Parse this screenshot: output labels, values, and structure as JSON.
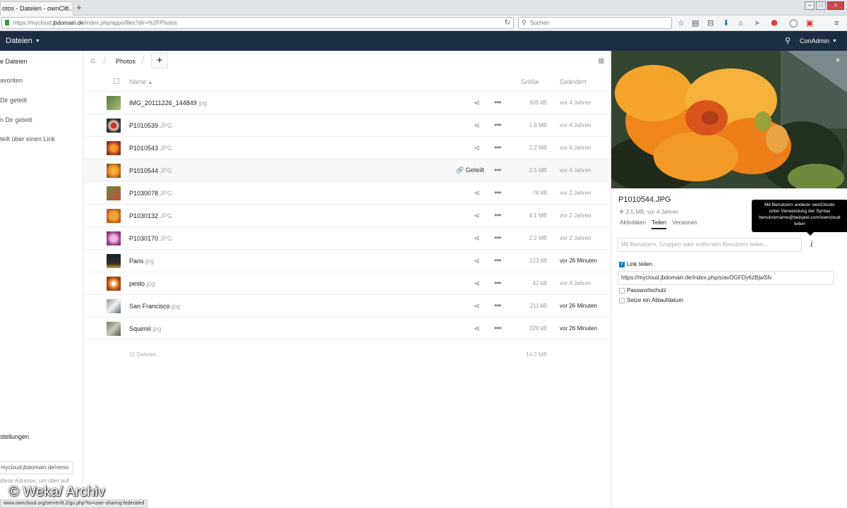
{
  "browser": {
    "tab_title": "otos - Dateien - ownClo...",
    "tab_close": "×",
    "new_tab": "+",
    "url_prefix": "https://mycloud.",
    "url_domain": "jbdomain.de",
    "url_path": "/index.php/apps/files?dir=%2FPhotos",
    "search_placeholder": "Suchen",
    "status_url": "www.owncloud.org/server/8.2/go.php?to=user-sharing-federated"
  },
  "header": {
    "app_name": "Dateien",
    "user_name": "ConAdmin"
  },
  "nav": {
    "items": [
      {
        "label": "e Dateien"
      },
      {
        "label": "avoriten"
      },
      {
        "label": "Dir geteilt"
      },
      {
        "label": "n Dir geteilt"
      },
      {
        "label": "teilt über einen Link"
      }
    ],
    "settings_label": "stellungen",
    "webdav_value": "mycloud.jbdomain.de/remo",
    "webdav_hint": "diese Adresse, um über auf"
  },
  "breadcrumb": {
    "folder": "Photos",
    "new_label": "+"
  },
  "columns": {
    "name": "Name",
    "size": "Größe",
    "modified": "Geändert"
  },
  "files": [
    {
      "name": "IMG_20111226_144849",
      "ext": ".jpg",
      "size": "605 kB",
      "modified": "vor 4 Jahren",
      "recent": false,
      "shared": false
    },
    {
      "name": "P1010539",
      "ext": ".JPG",
      "size": "1.9 MB",
      "modified": "vor 4 Jahren",
      "recent": false,
      "shared": false
    },
    {
      "name": "P1010543",
      "ext": ".JPG",
      "size": "2.2 MB",
      "modified": "vor 4 Jahren",
      "recent": false,
      "shared": false
    },
    {
      "name": "P1010544",
      "ext": ".JPG",
      "size": "2.5 MB",
      "modified": "vor 4 Jahren",
      "recent": false,
      "shared": true
    },
    {
      "name": "P1030078",
      "ext": ".JPG",
      "size": "76 kB",
      "modified": "vor 2 Jahren",
      "recent": false,
      "shared": false
    },
    {
      "name": "P1030132",
      "ext": ".JPG",
      "size": "4.1 MB",
      "modified": "vor 2 Jahren",
      "recent": false,
      "shared": false
    },
    {
      "name": "P1030170",
      "ext": ".JPG",
      "size": "2.2 MB",
      "modified": "vor 2 Jahren",
      "recent": false,
      "shared": false
    },
    {
      "name": "Paris",
      "ext": ".jpg",
      "size": "223 kB",
      "modified": "vor 26 Minuten",
      "recent": true,
      "shared": false
    },
    {
      "name": "pesto",
      "ext": ".jpg",
      "size": "42 kB",
      "modified": "vor 4 Jahren",
      "recent": false,
      "shared": false
    },
    {
      "name": "San Francisco",
      "ext": ".jpg",
      "size": "211 kB",
      "modified": "vor 26 Minuten",
      "recent": true,
      "shared": false
    },
    {
      "name": "Squirrel",
      "ext": ".jpg",
      "size": "228 kB",
      "modified": "vor 26 Minuten",
      "recent": true,
      "shared": false
    }
  ],
  "shared_label": "Geteilt",
  "summary": {
    "count": "11 Dateien",
    "total": "14.2 MB"
  },
  "sidebar": {
    "file_name": "P1010544.JPG",
    "meta": "2.5 MB, vor 4 Jahren",
    "tabs": [
      {
        "label": "Aktivitäten",
        "active": false
      },
      {
        "label": "Teilen",
        "active": true
      },
      {
        "label": "Versionen",
        "active": false
      }
    ],
    "tooltip_lines": [
      "Mit Benutzern anderer ownClouds",
      "unter Verwendung der Syntax",
      "benutzername@beispiel.com/owncloud",
      "teilen"
    ],
    "share_placeholder": "Mit Benutzern, Gruppen oder entfernten Benutzern teilen...",
    "link_share_label": "Link teilen",
    "link_url": "https://mycloud.jbdomain.de/index.php/s/avOGFDy6zBjwSfv",
    "password_label": "Passwortschutz",
    "expiry_label": "Setze ein Ablaufdatum"
  },
  "watermark": "© Weka/ Archiv",
  "colors": {
    "header_bg": "#1d2d44",
    "accent": "#0082c9"
  }
}
